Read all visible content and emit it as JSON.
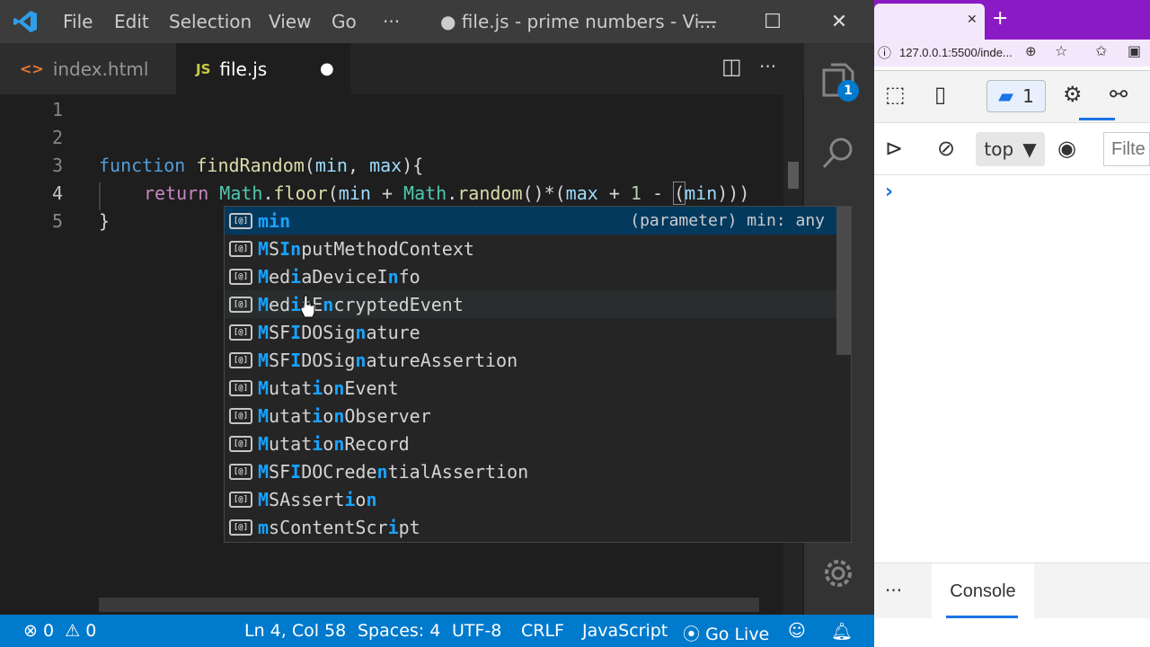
{
  "titlebar": {
    "menu": [
      "File",
      "Edit",
      "Selection",
      "View",
      "Go",
      "···"
    ],
    "title": "● file.js - prime numbers - Vi...",
    "minimize": "—",
    "maximize": "☐",
    "close": "✕"
  },
  "tabs": [
    {
      "icon": "<>",
      "label": "index.html"
    },
    {
      "icon": "JS",
      "label": "file.js",
      "dirty": "●"
    }
  ],
  "editor_actions": {
    "split": "◫",
    "more": "···"
  },
  "activity": {
    "explorer_badge": "1"
  },
  "editor": {
    "lines": [
      "1",
      "2",
      "3",
      "4",
      "5"
    ],
    "code": {
      "l3_kw": "function",
      "l3_fn": "findRandom",
      "l3_p1": "(",
      "l3_min": "min",
      "l3_comma": ", ",
      "l3_max": "max",
      "l3_end": "){",
      "l4_kw": "return",
      "l4_math": "Math",
      "l4_dot": ".",
      "l4_floor": "floor",
      "l4_open": "(",
      "l4_min": "min",
      "l4_plus": " + ",
      "l4_math2": "Math",
      "l4_dot2": ".",
      "l4_random": "random",
      "l4_mid": "()*(",
      "l4_max": "max",
      "l4_plus2": " + ",
      "l4_one": "1",
      "l4_minus": " - ",
      "l4_open2": "(",
      "l4_min2": "min",
      "l4_close": ")))",
      "l5": "}"
    }
  },
  "suggest": {
    "selected_detail": "(parameter) min: any",
    "items": [
      {
        "label": "min"
      },
      {
        "label": "MSInputMethodContext"
      },
      {
        "label": "MediaDeviceInfo"
      },
      {
        "label": "MediaEncryptedEvent"
      },
      {
        "label": "MSFIDOSignature"
      },
      {
        "label": "MSFIDOSignatureAssertion"
      },
      {
        "label": "MutationEvent"
      },
      {
        "label": "MutationObserver"
      },
      {
        "label": "MutationRecord"
      },
      {
        "label": "MSFIDOCredentialAssertion"
      },
      {
        "label": "MSAssertion"
      },
      {
        "label": "msContentScript"
      }
    ]
  },
  "statusbar": {
    "errors": "0",
    "warnings": "0",
    "position": "Ln 4, Col 58",
    "spaces": "Spaces: 4",
    "encoding": "UTF-8",
    "eol": "CRLF",
    "language": "JavaScript",
    "golive": "Go Live"
  },
  "browser": {
    "tab_close": "✕",
    "new_tab": "+",
    "url": "127.0.0.1:5500/inde...",
    "issues_count": "1",
    "context": "top",
    "filter_placeholder": "Filte",
    "prompt": "›",
    "drawer_more": "···",
    "drawer_tab": "Console"
  },
  "colors": {
    "statusbar": "#007acc",
    "browser_tabstrip": "#8a1ac4",
    "selected_suggestion": "#04395e",
    "match_highlight": "#18a3ff"
  }
}
